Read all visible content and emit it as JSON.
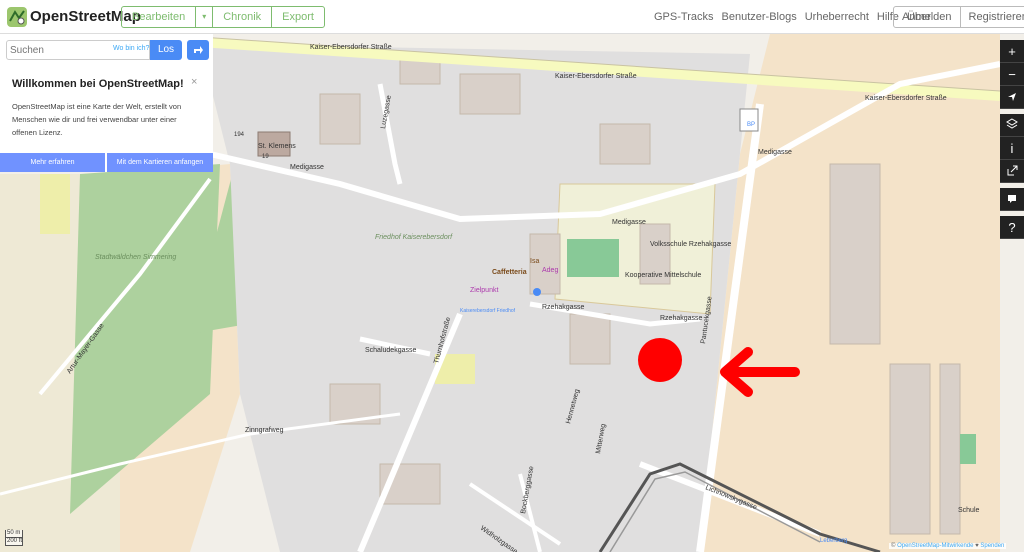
{
  "header": {
    "brand": "OpenStreetMap",
    "edit_buttons": [
      "Bearbeiten",
      "▾",
      "Chronik",
      "Export"
    ],
    "nav_links": [
      "GPS-Tracks",
      "Benutzer-Blogs",
      "Urheberrecht",
      "Hilfe",
      "Über"
    ],
    "auth": [
      "Anmelden",
      "Registrieren"
    ],
    "accent_color": "#7ebc6f"
  },
  "sidebar": {
    "search_placeholder": "Suchen",
    "where_link": "Wo bin ich?",
    "search_button": "Los",
    "welcome_title": "Willkommen bei OpenStreetMap!",
    "close": "×",
    "welcome_text": "OpenStreetMap ist eine Karte der Welt, erstellt von Menschen wie dir und frei verwendbar unter einer offenen Lizenz.",
    "learn_more": "Mehr erfahren",
    "start_mapping": "Mit dem Kartieren anfangen"
  },
  "controls": [
    "+",
    "−",
    "➤",
    "layers-icon",
    "i",
    "share-icon",
    "note-icon",
    "?"
  ],
  "scale": {
    "metric": "50 m",
    "imperial": "200 ft"
  },
  "attribution": {
    "prefix": "© ",
    "link": "OpenStreetMap-Mitwirkende",
    "sep": " ♥ ",
    "donate": "Spenden"
  },
  "map_labels": {
    "kaiser1": "Kaiser-Ebersdorfer Straße",
    "kaiser2": "Kaiser-Ebersdorfer Straße",
    "kaiser3": "Kaiser-Ebersdorfer Straße",
    "medigasse1": "Medigasse",
    "medigasse2": "Medigasse",
    "medigasse3": "Medigasse",
    "luzegasse": "Luzegasse",
    "stadtwaeldchen": "Stadtwäldchen Simmering",
    "friedhof": "Friedhof Kaiserebersdorf",
    "stkl": "St. Klemens",
    "volksschule": "Volksschule Rzehakgasse",
    "mittelschule": "Kooperative Mittelschule",
    "caffetteria": "Caffetteria",
    "adeg": "Adeg",
    "zielpunkt": "Zielpunkt",
    "isa": "Isa",
    "rzehak1": "Rzehakgasse",
    "rzehak2": "Rzehakgasse",
    "pantucek": "Pantucekgasse",
    "schaludek": "Schaludekgasse",
    "thurnhof": "Thurnhofstraße",
    "zinngraf": "Zinngrafweg",
    "artemayer": "Artur-Mayer-Gasse",
    "hennet": "Hennetweg",
    "mitter": "Mitterweg",
    "bockberg": "Bockberggasse",
    "widholz": "Widholzgasse",
    "lichnowsky": "Lichnowskygasse",
    "schule": "Schule",
    "leberberg": "Leberberg",
    "haltepunkt": "Kaiserebersdorf Friedhof",
    "bp": "BP",
    "n194": "194",
    "n19": "19"
  }
}
